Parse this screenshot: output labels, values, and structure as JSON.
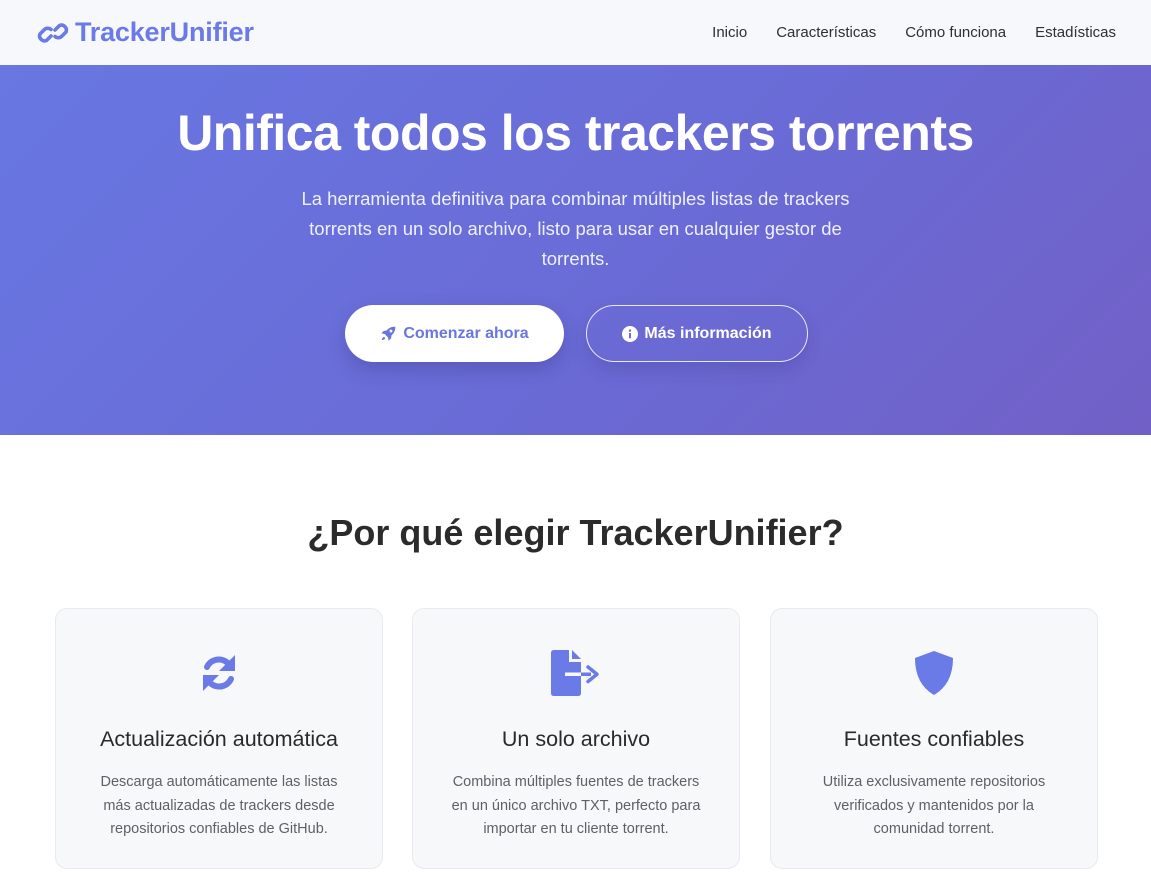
{
  "header": {
    "brand": "TrackerUnifier",
    "nav": [
      {
        "label": "Inicio"
      },
      {
        "label": "Características"
      },
      {
        "label": "Cómo funciona"
      },
      {
        "label": "Estadísticas"
      }
    ]
  },
  "hero": {
    "title": "Unifica todos los trackers torrents",
    "subtitle": "La herramienta definitiva para combinar múltiples listas de trackers torrents en un solo archivo, listo para usar en cualquier gestor de torrents.",
    "primary_button": "Comenzar ahora",
    "secondary_button": "Más información"
  },
  "features": {
    "title": "¿Por qué elegir TrackerUnifier?",
    "cards": [
      {
        "icon": "sync-icon",
        "title": "Actualización automática",
        "text": "Descarga automáticamente las listas más actualizadas de trackers desde repositorios confiables de GitHub."
      },
      {
        "icon": "file-export-icon",
        "title": "Un solo archivo",
        "text": "Combina múltiples fuentes de trackers en un único archivo TXT, perfecto para importar en tu cliente torrent."
      },
      {
        "icon": "shield-icon",
        "title": "Fuentes confiables",
        "text": "Utiliza exclusivamente repositorios verificados y mantenidos por la comunidad torrent."
      }
    ]
  },
  "colors": {
    "accent": "#6a76e0",
    "hero_gradient_start": "#6877e2",
    "hero_gradient_end": "#7160c6"
  }
}
